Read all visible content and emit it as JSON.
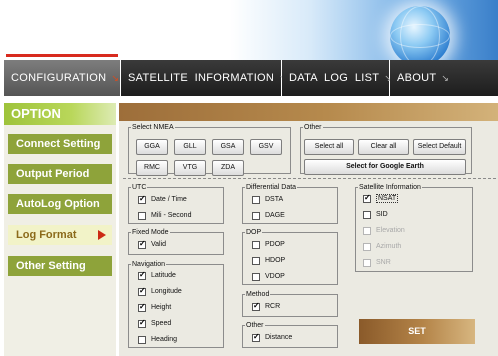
{
  "nav": {
    "tabs": [
      {
        "label": "CONFIGURATION",
        "active": true
      },
      {
        "label": "SATELLITE  INFORMATION",
        "active": false
      },
      {
        "label": "DATA  LOG  LIST",
        "active": false
      },
      {
        "label": "ABOUT",
        "active": false
      }
    ],
    "arrow_glyph": "↘"
  },
  "sidebar": {
    "title": "OPTION",
    "items": [
      {
        "label": "Connect Setting",
        "active": false
      },
      {
        "label": "Output Period",
        "active": false
      },
      {
        "label": "AutoLog Option",
        "active": false
      },
      {
        "label": "Log Format",
        "active": true
      },
      {
        "label": "Other Setting",
        "active": false
      }
    ]
  },
  "nmea": {
    "legend": "Select NMEA",
    "buttons": [
      "GGA",
      "GLL",
      "GSA",
      "GSV",
      "RMC",
      "VTG",
      "ZDA"
    ]
  },
  "other_top": {
    "legend": "Other",
    "select_all": "Select all",
    "clear_all": "Clear all",
    "select_default": "Select Default",
    "google_earth": "Select for Google Earth"
  },
  "utc": {
    "legend": "UTC",
    "items": [
      {
        "label": "Date / Time",
        "checked": true
      },
      {
        "label": "Mili - Second",
        "checked": false
      }
    ]
  },
  "fixed_mode": {
    "legend": "Fixed Mode",
    "items": [
      {
        "label": "Valid",
        "checked": true
      }
    ]
  },
  "navigation": {
    "legend": "Navigation",
    "items": [
      {
        "label": "Latitude",
        "checked": true
      },
      {
        "label": "Longitude",
        "checked": true
      },
      {
        "label": "Height",
        "checked": true
      },
      {
        "label": "Speed",
        "checked": true
      },
      {
        "label": "Heading",
        "checked": false
      }
    ]
  },
  "differential": {
    "legend": "Differential Data",
    "items": [
      {
        "label": "DSTA",
        "checked": false
      },
      {
        "label": "DAGE",
        "checked": false
      }
    ]
  },
  "dop": {
    "legend": "DOP",
    "items": [
      {
        "label": "PDOP",
        "checked": false
      },
      {
        "label": "HDOP",
        "checked": false
      },
      {
        "label": "VDOP",
        "checked": false
      }
    ]
  },
  "method": {
    "legend": "Method",
    "items": [
      {
        "label": "RCR",
        "checked": true
      }
    ]
  },
  "other_bottom": {
    "legend": "Other",
    "items": [
      {
        "label": "Distance",
        "checked": true
      }
    ]
  },
  "satellite": {
    "legend": "Satellite Information",
    "items": [
      {
        "label": "NSAT",
        "checked": true,
        "disabled": false
      },
      {
        "label": "SID",
        "checked": false,
        "disabled": false
      },
      {
        "label": "Elevation",
        "checked": false,
        "disabled": true
      },
      {
        "label": "Azimuth",
        "checked": false,
        "disabled": true
      },
      {
        "label": "SNR",
        "checked": false,
        "disabled": true
      }
    ]
  },
  "set_label": "SET",
  "colors": {
    "accent_green": "#8ea33a",
    "accent_brown": "#9d6e3a",
    "active_arrow": "#cc2a14",
    "nav_active": "#6a6a6a",
    "nav_dark": "#2a2a2a"
  }
}
